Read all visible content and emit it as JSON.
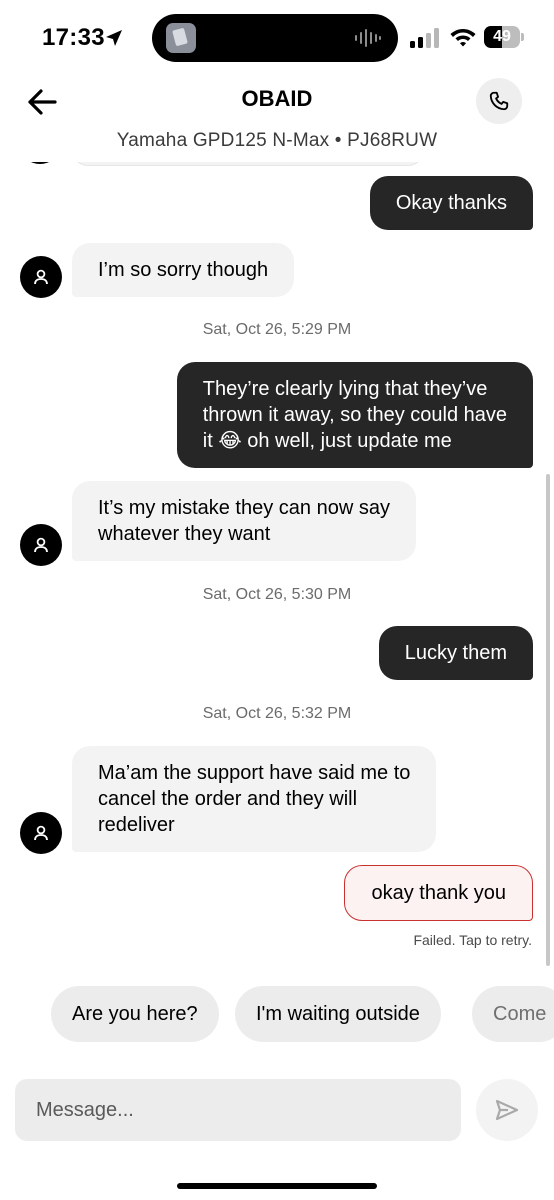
{
  "status_bar": {
    "time": "17:33",
    "battery": "49",
    "battery_level": 0.49,
    "icons": [
      "location-arrow-icon",
      "waveform-icon",
      "cellular-signal-icon",
      "wifi-icon",
      "battery-icon"
    ]
  },
  "header": {
    "title": "OBAID",
    "vehicle": "Yamaha GPD125 N-Max • PJ68RUW",
    "back_icon": "arrow-left-icon",
    "call_icon": "phone-icon"
  },
  "messages": [
    {
      "dir": "out",
      "text": "Okay thanks"
    },
    {
      "dir": "in",
      "text": "I’m so sorry though"
    },
    {
      "dir": "timestamp",
      "text": "Sat, Oct 26, 5:29 PM"
    },
    {
      "dir": "out",
      "line1": "They’re clearly lying that they’ve",
      "line2": "thrown it away, so they could have",
      "line3_pre": "it ",
      "emoji": "😂",
      "line3_post": " oh well, just update me"
    },
    {
      "dir": "in",
      "line1": "It’s my mistake they can now say",
      "line2": "whatever they want"
    },
    {
      "dir": "timestamp",
      "text": "Sat, Oct 26, 5:30 PM"
    },
    {
      "dir": "out",
      "text": "Lucky them"
    },
    {
      "dir": "timestamp",
      "text": "Sat, Oct 26, 5:32 PM"
    },
    {
      "dir": "in",
      "line1": "Ma’am the support have said me to",
      "line2": "cancel the order and they will",
      "line3": "redeliver"
    },
    {
      "dir": "out",
      "status": "failed",
      "text": "okay thank you",
      "note": "Failed. Tap to retry."
    }
  ],
  "quick_replies": [
    "Are you here?",
    "I'm waiting outside",
    "Come"
  ],
  "composer": {
    "placeholder": "Message...",
    "send_icon": "send-icon"
  },
  "colors": {
    "outgoing": "#262626",
    "incoming": "#f3f3f3",
    "failed_border": "#c9312f",
    "failed_bg": "#fdf2f2"
  }
}
